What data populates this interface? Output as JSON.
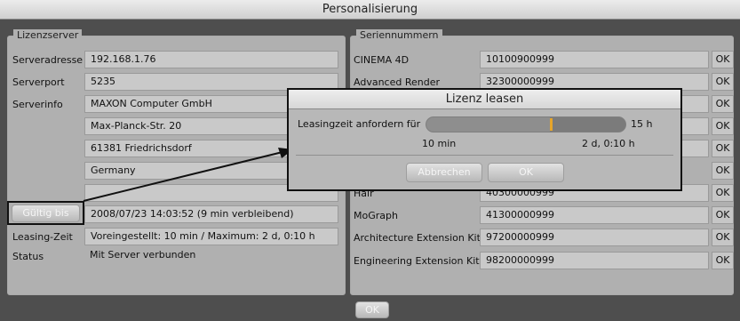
{
  "window": {
    "title": "Personalisierung"
  },
  "license_server": {
    "group_title": "Lizenzserver",
    "server_address_label": "Serveradresse",
    "server_address": "192.168.1.76",
    "server_port_label": "Serverport",
    "server_port": "5235",
    "server_info_label": "Serverinfo",
    "server_info": [
      "MAXON Computer GmbH",
      "Max-Planck-Str. 20",
      "61381 Friedrichsdorf",
      "Germany",
      ""
    ],
    "valid_until_button": "Gültig bis",
    "valid_until_value": "2008/07/23 14:03:52 (9 min verbleibend)",
    "leasing_time_label": "Leasing-Zeit",
    "leasing_time_value": "Voreingestellt: 10 min / Maximum: 2 d, 0:10 h",
    "status_label": "Status",
    "status_value": "Mit Server verbunden"
  },
  "serial_numbers": {
    "group_title": "Seriennummern",
    "ok_label": "OK",
    "items": [
      {
        "name": "CINEMA 4D",
        "serial": "10100900999"
      },
      {
        "name": "Advanced Render",
        "serial": "32300000999"
      },
      {
        "name": "",
        "serial": ""
      },
      {
        "name": "",
        "serial": ""
      },
      {
        "name": "",
        "serial": ""
      },
      {
        "name": "Hair",
        "serial": "40300000999"
      },
      {
        "name": "MoGraph",
        "serial": "41300000999"
      },
      {
        "name": "Architecture Extension Kit",
        "serial": "97200000999"
      },
      {
        "name": "Engineering Extension Kit",
        "serial": "98200000999"
      }
    ]
  },
  "footer": {
    "ok_label": "OK"
  },
  "lease_dialog": {
    "title": "Lizenz leasen",
    "request_label": "Leasingzeit anfordern für",
    "value": "15 h",
    "min_label": "10 min",
    "max_label": "2 d, 0:10 h",
    "slider_fraction": 0.62,
    "cancel_label": "Abbrechen",
    "ok_label": "OK"
  },
  "colors": {
    "slider_thumb": "#e6a52a",
    "highlight_border": "#111111"
  }
}
